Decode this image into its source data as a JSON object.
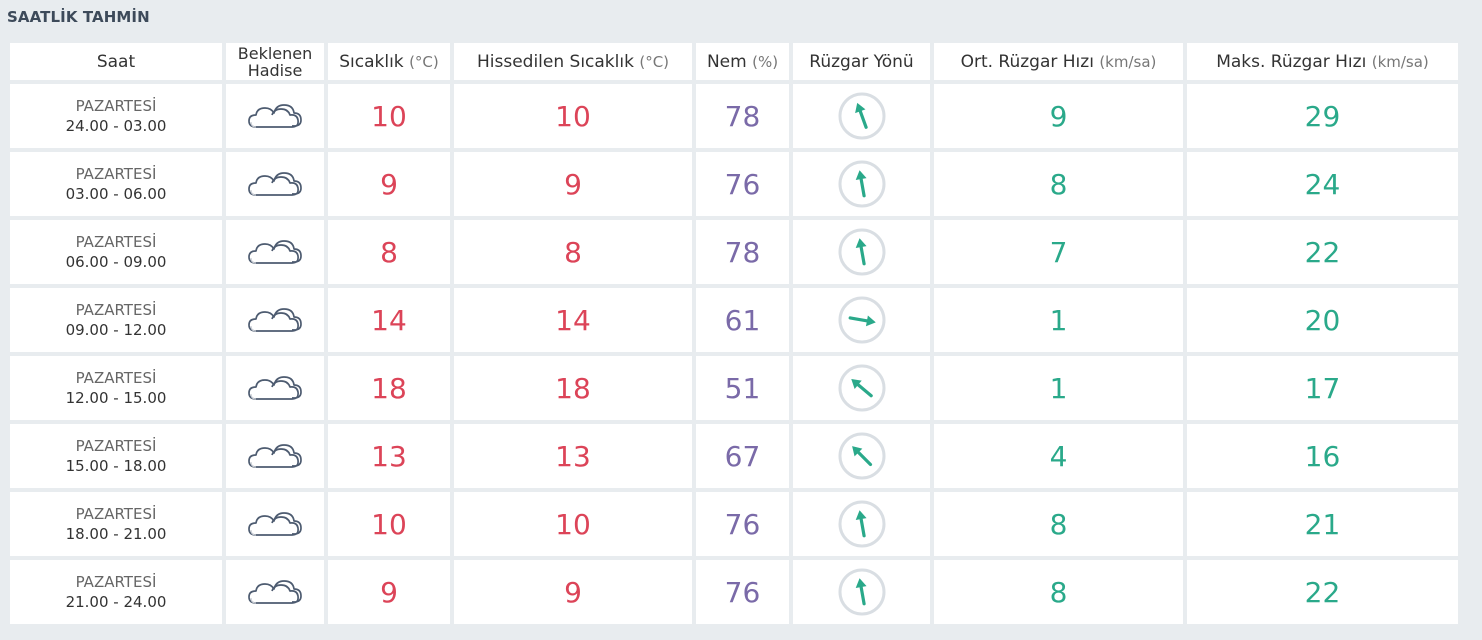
{
  "title": "SAATLİK TAHMİN",
  "headers": {
    "saat": "Saat",
    "hadise_line1": "Beklenen",
    "hadise_line2": "Hadise",
    "sicaklik": "Sıcaklık",
    "sicaklik_unit": "(°C)",
    "hissedilen": "Hissedilen Sıcaklık",
    "hissedilen_unit": "(°C)",
    "nem": "Nem",
    "nem_unit": "(%)",
    "ruzgar_yonu": "Rüzgar Yönü",
    "ort_ruzgar": "Ort. Rüzgar Hızı",
    "ort_ruzgar_unit": "(km/sa)",
    "maks_ruzgar": "Maks. Rüzgar Hızı",
    "maks_ruzgar_unit": "(km/sa)"
  },
  "colors": {
    "temperature": "#dc4458",
    "humidity": "#7a6aa8",
    "wind": "#2aa98a",
    "background": "#e8ecef"
  },
  "rows": [
    {
      "day": "PAZARTESİ",
      "hours": "24.00 - 03.00",
      "icon": "cloudy-icon",
      "temp": "10",
      "feels": "10",
      "humidity": "78",
      "wind_dir_deg": 340,
      "wind_avg": "9",
      "wind_max": "29"
    },
    {
      "day": "PAZARTESİ",
      "hours": "03.00 - 06.00",
      "icon": "cloudy-icon",
      "temp": "9",
      "feels": "9",
      "humidity": "76",
      "wind_dir_deg": 350,
      "wind_avg": "8",
      "wind_max": "24"
    },
    {
      "day": "PAZARTESİ",
      "hours": "06.00 - 09.00",
      "icon": "cloudy-icon",
      "temp": "8",
      "feels": "8",
      "humidity": "78",
      "wind_dir_deg": 350,
      "wind_avg": "7",
      "wind_max": "22"
    },
    {
      "day": "PAZARTESİ",
      "hours": "09.00 - 12.00",
      "icon": "cloudy-icon",
      "temp": "14",
      "feels": "14",
      "humidity": "61",
      "wind_dir_deg": 100,
      "wind_avg": "1",
      "wind_max": "20"
    },
    {
      "day": "PAZARTESİ",
      "hours": "12.00 - 15.00",
      "icon": "cloudy-icon",
      "temp": "18",
      "feels": "18",
      "humidity": "51",
      "wind_dir_deg": 310,
      "wind_avg": "1",
      "wind_max": "17"
    },
    {
      "day": "PAZARTESİ",
      "hours": "15.00 - 18.00",
      "icon": "cloudy-icon",
      "temp": "13",
      "feels": "13",
      "humidity": "67",
      "wind_dir_deg": 315,
      "wind_avg": "4",
      "wind_max": "16"
    },
    {
      "day": "PAZARTESİ",
      "hours": "18.00 - 21.00",
      "icon": "cloudy-icon",
      "temp": "10",
      "feels": "10",
      "humidity": "76",
      "wind_dir_deg": 350,
      "wind_avg": "8",
      "wind_max": "21"
    },
    {
      "day": "PAZARTESİ",
      "hours": "21.00 - 24.00",
      "icon": "cloudy-icon",
      "temp": "9",
      "feels": "9",
      "humidity": "76",
      "wind_dir_deg": 350,
      "wind_avg": "8",
      "wind_max": "22"
    }
  ]
}
